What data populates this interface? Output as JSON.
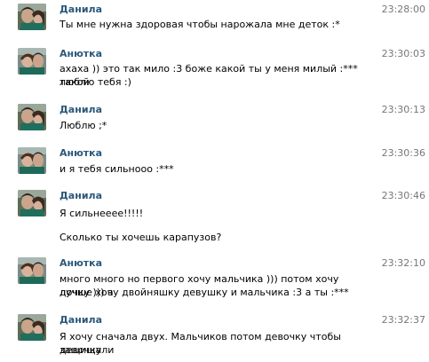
{
  "messages": [
    {
      "author": "Данила",
      "time": "23:28:00",
      "avatar": "danila-avatar",
      "lines": [
        "Ты мне нужна здоровая чтобы нарожала мне деток :*"
      ]
    },
    {
      "author": "Анютка",
      "time": "23:30:03",
      "avatar": "anyutka-avatar",
      "lines": [
        "ахаха )) это так мило :3 боже какой ты у меня милый :*** такой",
        "люблю тебя :)"
      ]
    },
    {
      "author": "Данила",
      "time": "23:30:13",
      "avatar": "danila-avatar",
      "lines": [
        "Люблю ;*"
      ]
    },
    {
      "author": "Анютка",
      "time": "23:30:36",
      "avatar": "anyutka-avatar",
      "lines": [
        "и я тебя сильнооо :***"
      ]
    },
    {
      "author": "Данила",
      "time": "23:30:46",
      "avatar": "danila-avatar",
      "lines": [
        "Я сильнееее!!!!!",
        "",
        "Сколько ты хочешь карапузов?"
      ]
    },
    {
      "author": "Анютка",
      "time": "23:32:10",
      "avatar": "anyutka-avatar",
      "lines": [
        "много много но первого хочу мальчика ))) потом хочу дочку ))) а",
        "лучше хочу двойняшку девушку и мальчика :3 а ты :***"
      ]
    },
    {
      "author": "Данила",
      "time": "23:32:37",
      "avatar": "danila-avatar",
      "lines": [
        "Я хочу сначала двух. Мальчиков потом девочку чтобы девочку",
        "защищали"
      ]
    }
  ]
}
